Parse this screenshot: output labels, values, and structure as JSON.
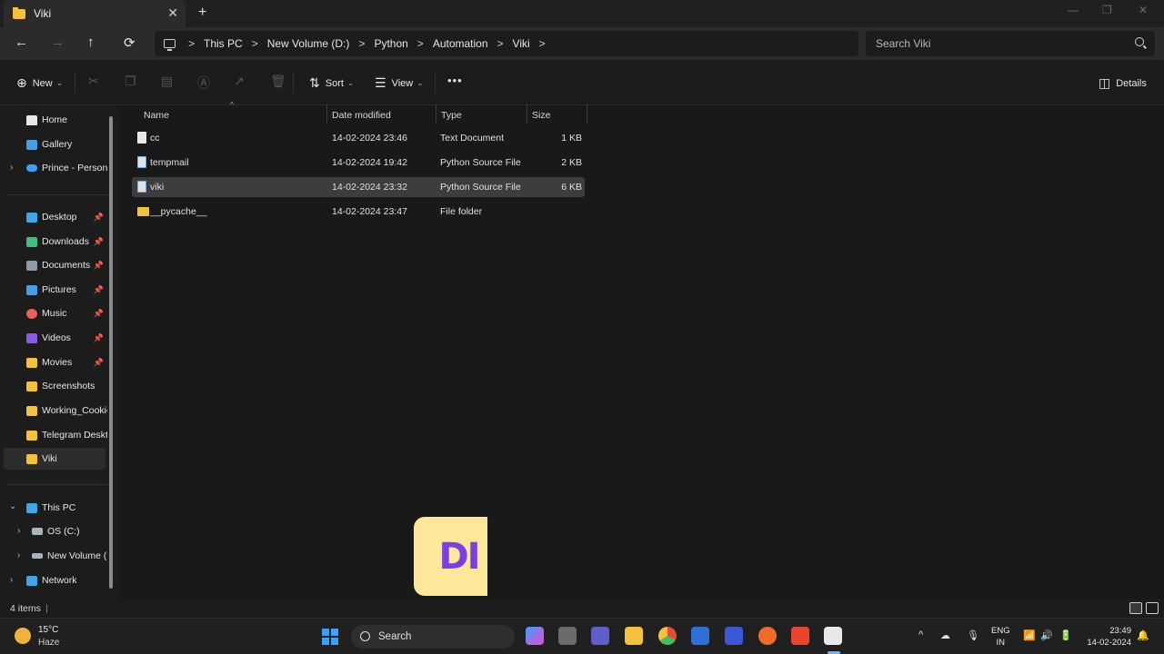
{
  "window": {
    "tab_title": "Viki",
    "tab_close": "✕",
    "new_tab": "+",
    "minimize": "—",
    "maximize": "❐",
    "close": "✕"
  },
  "nav": {
    "back": "←",
    "forward": "→",
    "up": "↑",
    "refresh": "⟳",
    "breadcrumbs": [
      "This PC",
      "New Volume (D:)",
      "Python",
      "Automation",
      "Viki"
    ],
    "separator": ">",
    "search_placeholder": "Search Viki"
  },
  "toolbar": {
    "new_label": "New",
    "sort_label": "Sort",
    "view_label": "View",
    "more_label": "•••",
    "details_label": "Details",
    "chevron": "⌄"
  },
  "sidebar": {
    "home": "Home",
    "gallery": "Gallery",
    "onedrive": "Prince - Persona",
    "quick_access": [
      {
        "label": "Desktop",
        "pinned": true,
        "color": "#3fa7e8"
      },
      {
        "label": "Downloads",
        "pinned": true,
        "color": "#3fbf7f"
      },
      {
        "label": "Documents",
        "pinned": true,
        "color": "#8e9aa8"
      },
      {
        "label": "Pictures",
        "pinned": true,
        "color": "#4a9be8"
      },
      {
        "label": "Music",
        "pinned": true,
        "color": "#e8625a"
      },
      {
        "label": "Videos",
        "pinned": true,
        "color": "#8a5ae8"
      },
      {
        "label": "Movies",
        "pinned": true,
        "color": "#f3c13b"
      },
      {
        "label": "Screenshots",
        "pinned": false,
        "color": "#f3c13b"
      },
      {
        "label": "Working_Cookie",
        "pinned": false,
        "color": "#f3c13b"
      },
      {
        "label": "Telegram Deskto",
        "pinned": false,
        "color": "#f3c13b"
      },
      {
        "label": "Viki",
        "pinned": false,
        "color": "#f3c13b"
      }
    ],
    "this_pc": "This PC",
    "drive_c": "OS (C:)",
    "drive_d": "New Volume (I",
    "network": "Network",
    "pin_glyph": "📌",
    "expand_glyph": "›",
    "collapse_glyph": "⌄"
  },
  "list": {
    "columns": {
      "name": "Name",
      "date": "Date modified",
      "type": "Type",
      "size": "Size"
    },
    "sort_indicator": "^",
    "rows": [
      {
        "name": "cc",
        "date": "14-02-2024 23:46",
        "type": "Text Document",
        "size": "1 KB",
        "kind": "txt"
      },
      {
        "name": "tempmail",
        "date": "14-02-2024 19:42",
        "type": "Python Source File",
        "size": "2 KB",
        "kind": "py"
      },
      {
        "name": "viki",
        "date": "14-02-2024 23:32",
        "type": "Python Source File",
        "size": "6 KB",
        "kind": "py",
        "selected": true
      },
      {
        "name": "__pycache__",
        "date": "14-02-2024 23:47",
        "type": "File folder",
        "size": "",
        "kind": "folder"
      }
    ]
  },
  "status": {
    "item_count": "4 items",
    "bar": "|"
  },
  "logo_text": "DI",
  "taskbar": {
    "temperature": "15°C",
    "weather": "Haze",
    "search_label": "Search",
    "language": "ENG",
    "region": "IN",
    "time": "23:49",
    "date": "14-02-2024",
    "tray_chevron": "^"
  }
}
